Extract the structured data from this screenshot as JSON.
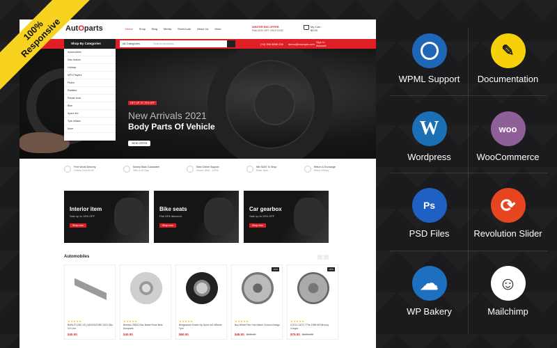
{
  "ribbon": {
    "line1": "100%",
    "line2": "Responsive"
  },
  "shop": {
    "logo_a": "Aut",
    "logo_o": "O",
    "logo_b": "parts",
    "nav": [
      "Home",
      "Shop",
      "Blog",
      "Media",
      "ShortCode",
      "About Us",
      "More"
    ],
    "offer_title": "WINTER BIG OFFER",
    "offer_sub": "Flat 20% OFF ON FOOD",
    "cart_label": "My Cart",
    "cart_total": "$0.00",
    "category_button": "Shop By Categories",
    "search_category": "All Categories",
    "search_placeholder": "Search products...",
    "phone": "(+0) 998 8888 226",
    "email": "demo@example.com",
    "signin": "Sign In",
    "account": "Account",
    "categories": [
      "Automobiles",
      "Disc brakes",
      "Hubcap",
      "MP3 Players",
      "Piston",
      "Radiator",
      "Repair tools",
      "Bike",
      "Spare tire",
      "Tyre inflator",
      "More"
    ],
    "hero": {
      "tag": "GET UP TO 70% OFF",
      "line1": "New Arrivals 2021",
      "line2": "Body Parts Of Vehicle",
      "button": "VIEW OFFER"
    },
    "features": [
      {
        "title": "Free World Delivery",
        "sub": "Orders Over $100"
      },
      {
        "title": "Money Back Guarantee",
        "sub": "With A 30 Day"
      },
      {
        "title": "Best Online Support",
        "sub": "Hours: 8AM - 11PM"
      },
      {
        "title": "Win $100 To Shop",
        "sub": "Enter Now"
      },
      {
        "title": "Return & Exchange",
        "sub": "Return Policy"
      }
    ],
    "banners": [
      {
        "title": "Interior item",
        "sub": "Sale up to 15% OFF",
        "button": "Shop now"
      },
      {
        "title": "Bike seats",
        "sub": "Flat 15% discount",
        "button": "Shop now"
      },
      {
        "title": "Car gearbox",
        "sub": "Sale up to 25% OFF",
        "button": "Shop now"
      }
    ],
    "section_title": "Automobiles",
    "products": [
      {
        "name": "BMW R 1250 GS | ADVENTURE 2021 Slip-On Line",
        "price": "$40.00",
        "old": "",
        "sale": "",
        "icon": "exhaust"
      },
      {
        "name": "Brembo 25524 Disc Brake Rotor Best Autoparts",
        "price": "$40.00",
        "old": "",
        "sale": "",
        "icon": "disc"
      },
      {
        "name": "Bridgestone Dueler Ap Sport 4x4 Wheels Tyre",
        "price": "$60.00",
        "old": "",
        "sale": "",
        "icon": "tyre"
      },
      {
        "name": "Buy Wheel Rim Hub Watch Custom Design",
        "price": "$45.00",
        "old": "$50.00",
        "sale": "-10%",
        "icon": "hub"
      },
      {
        "name": "COOL CATS 7 The 1995-98 Mercury Cougar",
        "price": "$75.00",
        "old": "$100.00",
        "sale": "-25%",
        "icon": "brake"
      }
    ]
  },
  "features_grid": [
    {
      "label": "WPML Support",
      "icon": "wpml-icon",
      "color": "#1e67b6",
      "glyph": ""
    },
    {
      "label": "Documentation",
      "icon": "documentation-icon",
      "color": "#f6d10a",
      "glyph": "✎"
    },
    {
      "label": "Wordpress",
      "icon": "wordpress-icon",
      "color": "#1a6fb5",
      "glyph": "W"
    },
    {
      "label": "WooCommerce",
      "icon": "woocommerce-icon",
      "color": "#8f5f9a",
      "glyph": "woo"
    },
    {
      "label": "PSD Files",
      "icon": "psd-icon",
      "color": "#1e61c2",
      "glyph": "Ps"
    },
    {
      "label": "Revolution Slider",
      "icon": "revolution-slider-icon",
      "color": "#e6451f",
      "glyph": "⟳"
    },
    {
      "label": "WP Bakery",
      "icon": "wpbakery-icon",
      "color": "#1d6fbf",
      "glyph": "☁"
    },
    {
      "label": "Mailchimp",
      "icon": "mailchimp-icon",
      "color": "#ffffff",
      "glyph": "☺"
    }
  ]
}
